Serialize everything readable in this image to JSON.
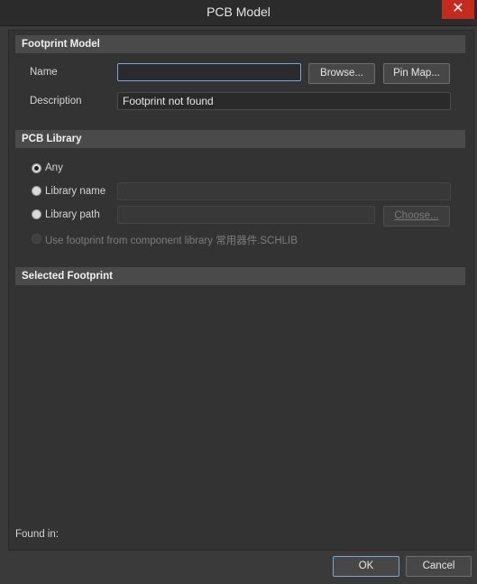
{
  "window": {
    "title": "PCB Model",
    "close_glyph": "✕"
  },
  "footprint_model": {
    "header": "Footprint Model",
    "name_label": "Name",
    "name_value": "",
    "browse_button": "Browse...",
    "pin_map_button": "Pin Map...",
    "description_label": "Description",
    "description_value": "Footprint not found"
  },
  "pcb_library": {
    "header": "PCB Library",
    "options": [
      {
        "label": "Any",
        "selected": true
      },
      {
        "label": "Library name",
        "selected": false
      },
      {
        "label": "Library path",
        "selected": false
      }
    ],
    "library_name_value": "",
    "library_path_value": "",
    "choose_button": "Choose...",
    "use_footprint_label": "Use footprint from component library 常用器件.SCHLIB"
  },
  "selected_footprint": {
    "header": "Selected Footprint",
    "found_in_label": "Found in:"
  },
  "footer": {
    "ok_button": "OK",
    "cancel_button": "Cancel"
  }
}
